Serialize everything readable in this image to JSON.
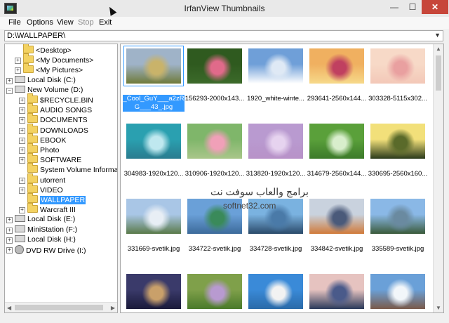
{
  "window": {
    "title": "IrfanView Thumbnails",
    "minimize": "—",
    "maximize": "☐",
    "close": "✕"
  },
  "menu": [
    {
      "label": "File",
      "enabled": true
    },
    {
      "label": "Options",
      "enabled": true
    },
    {
      "label": "View",
      "enabled": true
    },
    {
      "label": "Stop",
      "enabled": false
    },
    {
      "label": "Exit",
      "enabled": true
    }
  ],
  "path": {
    "value": "D:\\WALLPAPER\\"
  },
  "tree": [
    {
      "label": "<Desktop>",
      "icon": "folder-icon",
      "expander": ""
    },
    {
      "label": "<My Documents>",
      "icon": "folder-icon",
      "expander": "+"
    },
    {
      "label": "<My Pictures>",
      "icon": "folder-icon",
      "expander": "+"
    },
    {
      "label": "Local Disk (C:)",
      "icon": "drive-icon",
      "expander": "+"
    },
    {
      "label": "New Volume (D:)",
      "icon": "drive-icon",
      "expander": "−"
    },
    {
      "label": "$RECYCLE.BIN",
      "icon": "folder-icon",
      "expander": "+"
    },
    {
      "label": "AUDIO SONGS",
      "icon": "folder-icon",
      "expander": "+"
    },
    {
      "label": "DOCUMENTS",
      "icon": "folder-icon",
      "expander": "+"
    },
    {
      "label": "DOWNLOADS",
      "icon": "folder-icon",
      "expander": "+"
    },
    {
      "label": "EBOOK",
      "icon": "folder-icon",
      "expander": "+"
    },
    {
      "label": "Photo",
      "icon": "folder-icon",
      "expander": "+"
    },
    {
      "label": "SOFTWARE",
      "icon": "folder-icon",
      "expander": "+"
    },
    {
      "label": "System Volume Informatio",
      "icon": "folder-icon",
      "expander": ""
    },
    {
      "label": "utorrent",
      "icon": "folder-icon",
      "expander": "+"
    },
    {
      "label": "VIDEO",
      "icon": "folder-icon",
      "expander": "+"
    },
    {
      "label": "WALLPAPER",
      "icon": "folder-icon",
      "expander": "",
      "selected": true
    },
    {
      "label": "Warcraft III",
      "icon": "folder-icon",
      "expander": "+"
    },
    {
      "label": "Local Disk (E:)",
      "icon": "drive-icon",
      "expander": "+"
    },
    {
      "label": "MiniStation (F:)",
      "icon": "drive-icon",
      "expander": "+"
    },
    {
      "label": "Local Disk (H:)",
      "icon": "drive-icon",
      "expander": "+"
    },
    {
      "label": "DVD RW Drive (I:)",
      "icon": "dvd-icon",
      "expander": "+"
    }
  ],
  "thumbnails": [
    {
      "caption": "_Cool_GuY___a2zR G___43_.jpg",
      "selected": true,
      "colors": [
        "#9fb3c8",
        "#c9b36a",
        "#6f7a3a"
      ]
    },
    {
      "caption": "156293-2000x143...",
      "colors": [
        "#2f5a1f",
        "#e06a8a",
        "#3c6a2a"
      ]
    },
    {
      "caption": "1920_white-winte...",
      "colors": [
        "#6f9fd8",
        "#dfe9f5",
        "#ffffff"
      ]
    },
    {
      "caption": "293641-2560x144...",
      "colors": [
        "#f0b060",
        "#c04060",
        "#f6d98a"
      ]
    },
    {
      "caption": "303328-5115x302...",
      "colors": [
        "#f7d9c7",
        "#e9a0a0",
        "#f3c8b8"
      ]
    },
    {
      "caption": "304983-1920x120...",
      "colors": [
        "#2aa0b0",
        "#bfe8ef",
        "#2a7c8f"
      ]
    },
    {
      "caption": "310906-1920x120...",
      "colors": [
        "#7fb66a",
        "#f0a0b8",
        "#a9c68a"
      ]
    },
    {
      "caption": "313820-1920x120...",
      "colors": [
        "#b99ad0",
        "#e6d3ef",
        "#b892c8"
      ]
    },
    {
      "caption": "314679-2560x144...",
      "colors": [
        "#5aa03a",
        "#d8eecc",
        "#3c7a2a"
      ]
    },
    {
      "caption": "330695-2560x160...",
      "colors": [
        "#f2e07a",
        "#5a6a2a",
        "#2a3a1a"
      ]
    },
    {
      "caption": "331669-svetik.jpg",
      "colors": [
        "#a9c6e6",
        "#e8eef5",
        "#5a7a4a"
      ]
    },
    {
      "caption": "334722-svetik.jpg",
      "colors": [
        "#6aa0d8",
        "#3a8a5a",
        "#3c6a9a"
      ]
    },
    {
      "caption": "334728-svetik.jpg",
      "colors": [
        "#7ab2e0",
        "#4a7aa8",
        "#2a4a6a"
      ]
    },
    {
      "caption": "334842-svetik.jpg",
      "colors": [
        "#c9d2de",
        "#4a5a7a",
        "#d07a3a"
      ]
    },
    {
      "caption": "335589-svetik.jpg",
      "colors": [
        "#8ab8e6",
        "#6a8aa0",
        "#3a5a3a"
      ]
    },
    {
      "caption": "",
      "colors": [
        "#3a3a6a",
        "#c9a06a",
        "#1a1a3a"
      ]
    },
    {
      "caption": "",
      "colors": [
        "#7fa04a",
        "#b89ad0",
        "#4a7a2a"
      ]
    },
    {
      "caption": "",
      "colors": [
        "#3a8ad8",
        "#f2f2f2",
        "#2a6aa8"
      ]
    },
    {
      "caption": "",
      "colors": [
        "#e6c3c0",
        "#4a5a8a",
        "#2a3a5a"
      ]
    },
    {
      "caption": "",
      "colors": [
        "#6aa0d8",
        "#f2f6fa",
        "#7a5a4a"
      ]
    }
  ],
  "watermark": {
    "line1": "برامج والعاب سوفت نت",
    "line2": "softnet32.com"
  }
}
